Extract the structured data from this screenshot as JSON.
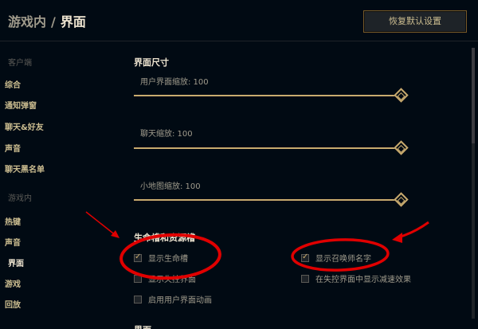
{
  "header": {
    "breadcrumb_parent": "游戏内",
    "breadcrumb_separator": "/",
    "breadcrumb_current": "界面",
    "restore_button": "恢复默认设置"
  },
  "sidebar": {
    "group_client": "客户端",
    "client_items": [
      "综合",
      "通知弹窗",
      "聊天&好友",
      "声音",
      "聊天黑名单"
    ],
    "group_ingame": "游戏内",
    "ingame_items": [
      "热键",
      "声音",
      "界面",
      "游戏",
      "回放"
    ],
    "active_item": "界面"
  },
  "main": {
    "interface_size_title": "界面尺寸",
    "sliders": [
      {
        "label": "用户界面缩放: 100",
        "value": 100
      },
      {
        "label": "聊天缩放: 100",
        "value": 100
      },
      {
        "label": "小地图缩放: 100",
        "value": 100
      }
    ],
    "health_section_title": "生命槽和资源槽",
    "checkboxes_left": [
      {
        "label": "显示生命槽",
        "checked": true
      },
      {
        "label": "显示失控界面",
        "checked": false
      },
      {
        "label": "启用用户界面动画",
        "checked": false
      }
    ],
    "checkboxes_right": [
      {
        "label": "显示召唤师名字",
        "checked": true
      },
      {
        "label": "在失控界面中显示减速效果",
        "checked": false
      }
    ],
    "next_section_title": "界面"
  },
  "colors": {
    "background": "#010a13",
    "gold": "#c8aa6e",
    "gold_dark": "#785a28",
    "title_text": "#f0e6d2",
    "annotation_red": "#e00000"
  }
}
